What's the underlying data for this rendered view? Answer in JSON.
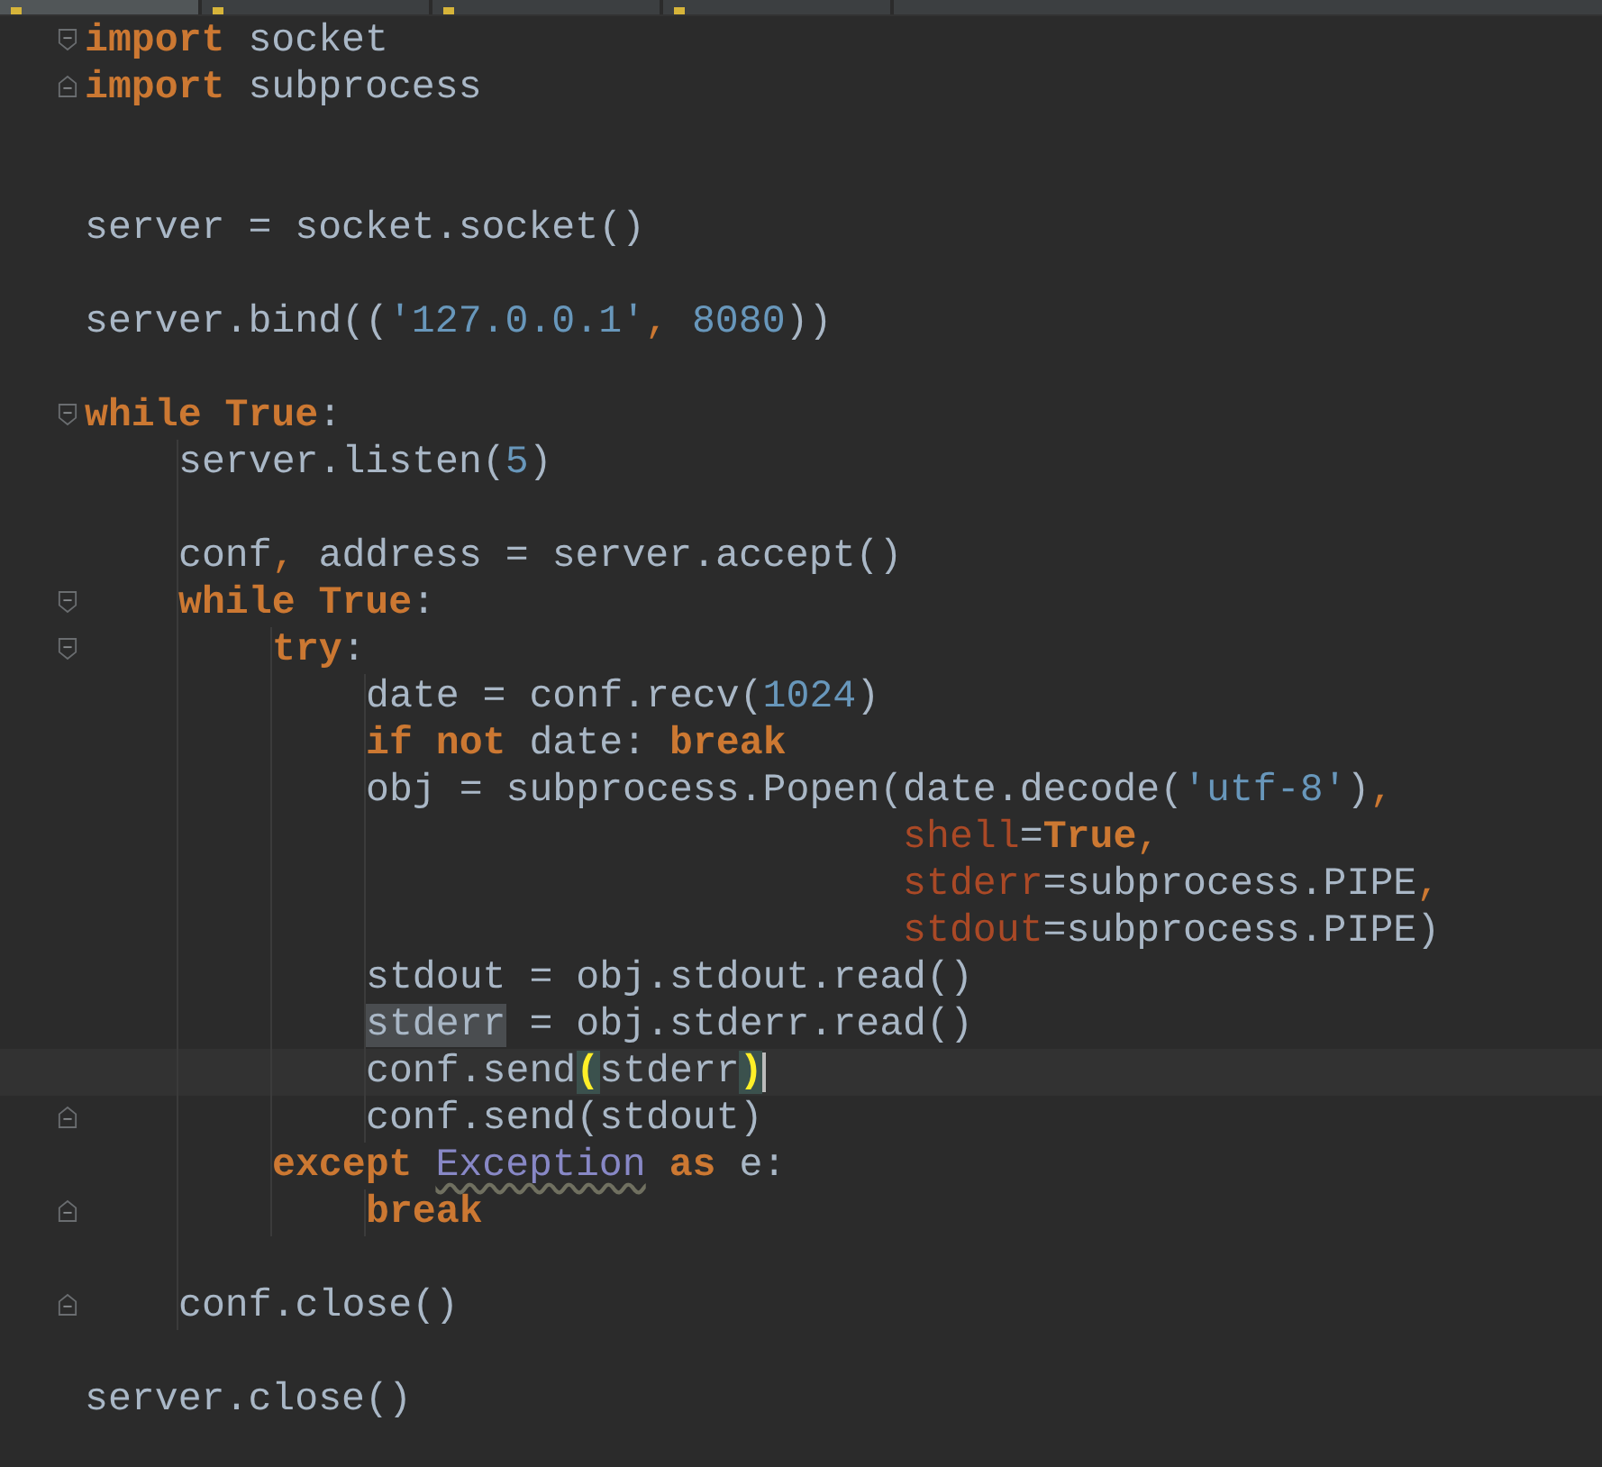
{
  "tabs": [
    {
      "selected": true
    },
    {
      "selected": false
    },
    {
      "selected": false
    },
    {
      "selected": false
    }
  ],
  "lines": [
    {
      "kind": "code",
      "fold_start": true,
      "tokens": [
        {
          "kind": "kw",
          "text": "import"
        },
        {
          "kind": "plain",
          "text": " socket"
        }
      ]
    },
    {
      "kind": "code",
      "fold_end": true,
      "tokens": [
        {
          "kind": "kw",
          "text": "import"
        },
        {
          "kind": "plain",
          "text": " subprocess"
        }
      ]
    },
    {
      "kind": "blank"
    },
    {
      "kind": "blank"
    },
    {
      "kind": "code",
      "tokens": [
        {
          "kind": "plain",
          "text": "server = socket.socket()"
        }
      ]
    },
    {
      "kind": "blank"
    },
    {
      "kind": "code",
      "tokens": [
        {
          "kind": "plain",
          "text": "server.bind(("
        },
        {
          "kind": "str",
          "text": "'127.0.0.1'"
        },
        {
          "kind": "punct",
          "text": ", "
        },
        {
          "kind": "num",
          "text": "8080"
        },
        {
          "kind": "plain",
          "text": "))"
        }
      ]
    },
    {
      "kind": "blank"
    },
    {
      "kind": "code",
      "fold_start": true,
      "tokens": [
        {
          "kind": "kw",
          "text": "while True"
        },
        {
          "kind": "plain",
          "text": ":"
        }
      ],
      "children": [
        {
          "kind": "code",
          "tokens": [
            {
              "kind": "plain",
              "text": "server.listen("
            },
            {
              "kind": "num",
              "text": "5"
            },
            {
              "kind": "plain",
              "text": ")"
            }
          ]
        },
        {
          "kind": "blank"
        },
        {
          "kind": "code",
          "tokens": [
            {
              "kind": "plain",
              "text": "conf"
            },
            {
              "kind": "punct",
              "text": ", "
            },
            {
              "kind": "plain",
              "text": "address = server.accept()"
            }
          ]
        },
        {
          "kind": "code",
          "fold_start": true,
          "tokens": [
            {
              "kind": "kw",
              "text": "while True"
            },
            {
              "kind": "plain",
              "text": ":"
            }
          ],
          "children": [
            {
              "kind": "code",
              "fold_start": true,
              "tokens": [
                {
                  "kind": "kw",
                  "text": "try"
                },
                {
                  "kind": "plain",
                  "text": ":"
                }
              ],
              "children": [
                {
                  "kind": "code",
                  "tokens": [
                    {
                      "kind": "plain",
                      "text": "date = conf.recv("
                    },
                    {
                      "kind": "num",
                      "text": "1024"
                    },
                    {
                      "kind": "plain",
                      "text": ")"
                    }
                  ]
                },
                {
                  "kind": "code",
                  "tokens": [
                    {
                      "kind": "kw",
                      "text": "if not"
                    },
                    {
                      "kind": "plain",
                      "text": " date: "
                    },
                    {
                      "kind": "kw",
                      "text": "break"
                    }
                  ]
                },
                {
                  "kind": "code",
                  "tokens": [
                    {
                      "kind": "plain",
                      "text": "obj = subprocess.Popen(date.decode("
                    },
                    {
                      "kind": "str",
                      "text": "'utf-8'"
                    },
                    {
                      "kind": "plain",
                      "text": ")"
                    },
                    {
                      "kind": "punct",
                      "text": ","
                    }
                  ]
                },
                {
                  "kind": "code",
                  "tokens": [
                    {
                      "kind": "param",
                      "text": "                       shell"
                    },
                    {
                      "kind": "plain",
                      "text": "="
                    },
                    {
                      "kind": "kw",
                      "text": "True"
                    },
                    {
                      "kind": "punct",
                      "text": ","
                    }
                  ]
                },
                {
                  "kind": "code",
                  "tokens": [
                    {
                      "kind": "param",
                      "text": "                       stderr"
                    },
                    {
                      "kind": "plain",
                      "text": "=subprocess.PIPE"
                    },
                    {
                      "kind": "punct",
                      "text": ","
                    }
                  ]
                },
                {
                  "kind": "code",
                  "tokens": [
                    {
                      "kind": "param",
                      "text": "                       stdout"
                    },
                    {
                      "kind": "plain",
                      "text": "=subprocess.PIPE)"
                    }
                  ]
                },
                {
                  "kind": "code",
                  "tokens": [
                    {
                      "kind": "plain",
                      "text": "stdout = obj.stdout.read()"
                    }
                  ]
                },
                {
                  "kind": "code",
                  "tokens": [
                    {
                      "kind": "plain",
                      "text": "stderr",
                      "highlighted": true
                    },
                    {
                      "kind": "plain",
                      "text": " = obj.stderr.read()"
                    }
                  ]
                },
                {
                  "kind": "code",
                  "current": true,
                  "tokens": [
                    {
                      "kind": "plain",
                      "text": "conf.send"
                    },
                    {
                      "kind": "plain",
                      "text": "(",
                      "matched": true
                    },
                    {
                      "kind": "plain",
                      "text": "stderr"
                    },
                    {
                      "kind": "plain",
                      "text": ")",
                      "matched": true
                    }
                  ]
                },
                {
                  "kind": "code",
                  "fold_end": true,
                  "tokens": [
                    {
                      "kind": "plain",
                      "text": "conf.send(stdout)"
                    }
                  ]
                }
              ]
            },
            {
              "kind": "code",
              "tokens": [
                {
                  "kind": "kw",
                  "text": "except "
                },
                {
                  "kind": "builtin",
                  "text": "Exception",
                  "warning": true
                },
                {
                  "kind": "kw",
                  "text": " as"
                },
                {
                  "kind": "plain",
                  "text": " e:"
                }
              ],
              "children": [
                {
                  "kind": "code",
                  "fold_end": true,
                  "tokens": [
                    {
                      "kind": "kw",
                      "text": "break"
                    }
                  ]
                }
              ]
            }
          ]
        },
        {
          "kind": "blank"
        },
        {
          "kind": "code",
          "fold_end": true,
          "tokens": [
            {
              "kind": "plain",
              "text": "conf.close()"
            }
          ]
        }
      ]
    },
    {
      "kind": "blank"
    },
    {
      "kind": "code",
      "tokens": [
        {
          "kind": "plain",
          "text": "server.close()"
        }
      ]
    }
  ]
}
